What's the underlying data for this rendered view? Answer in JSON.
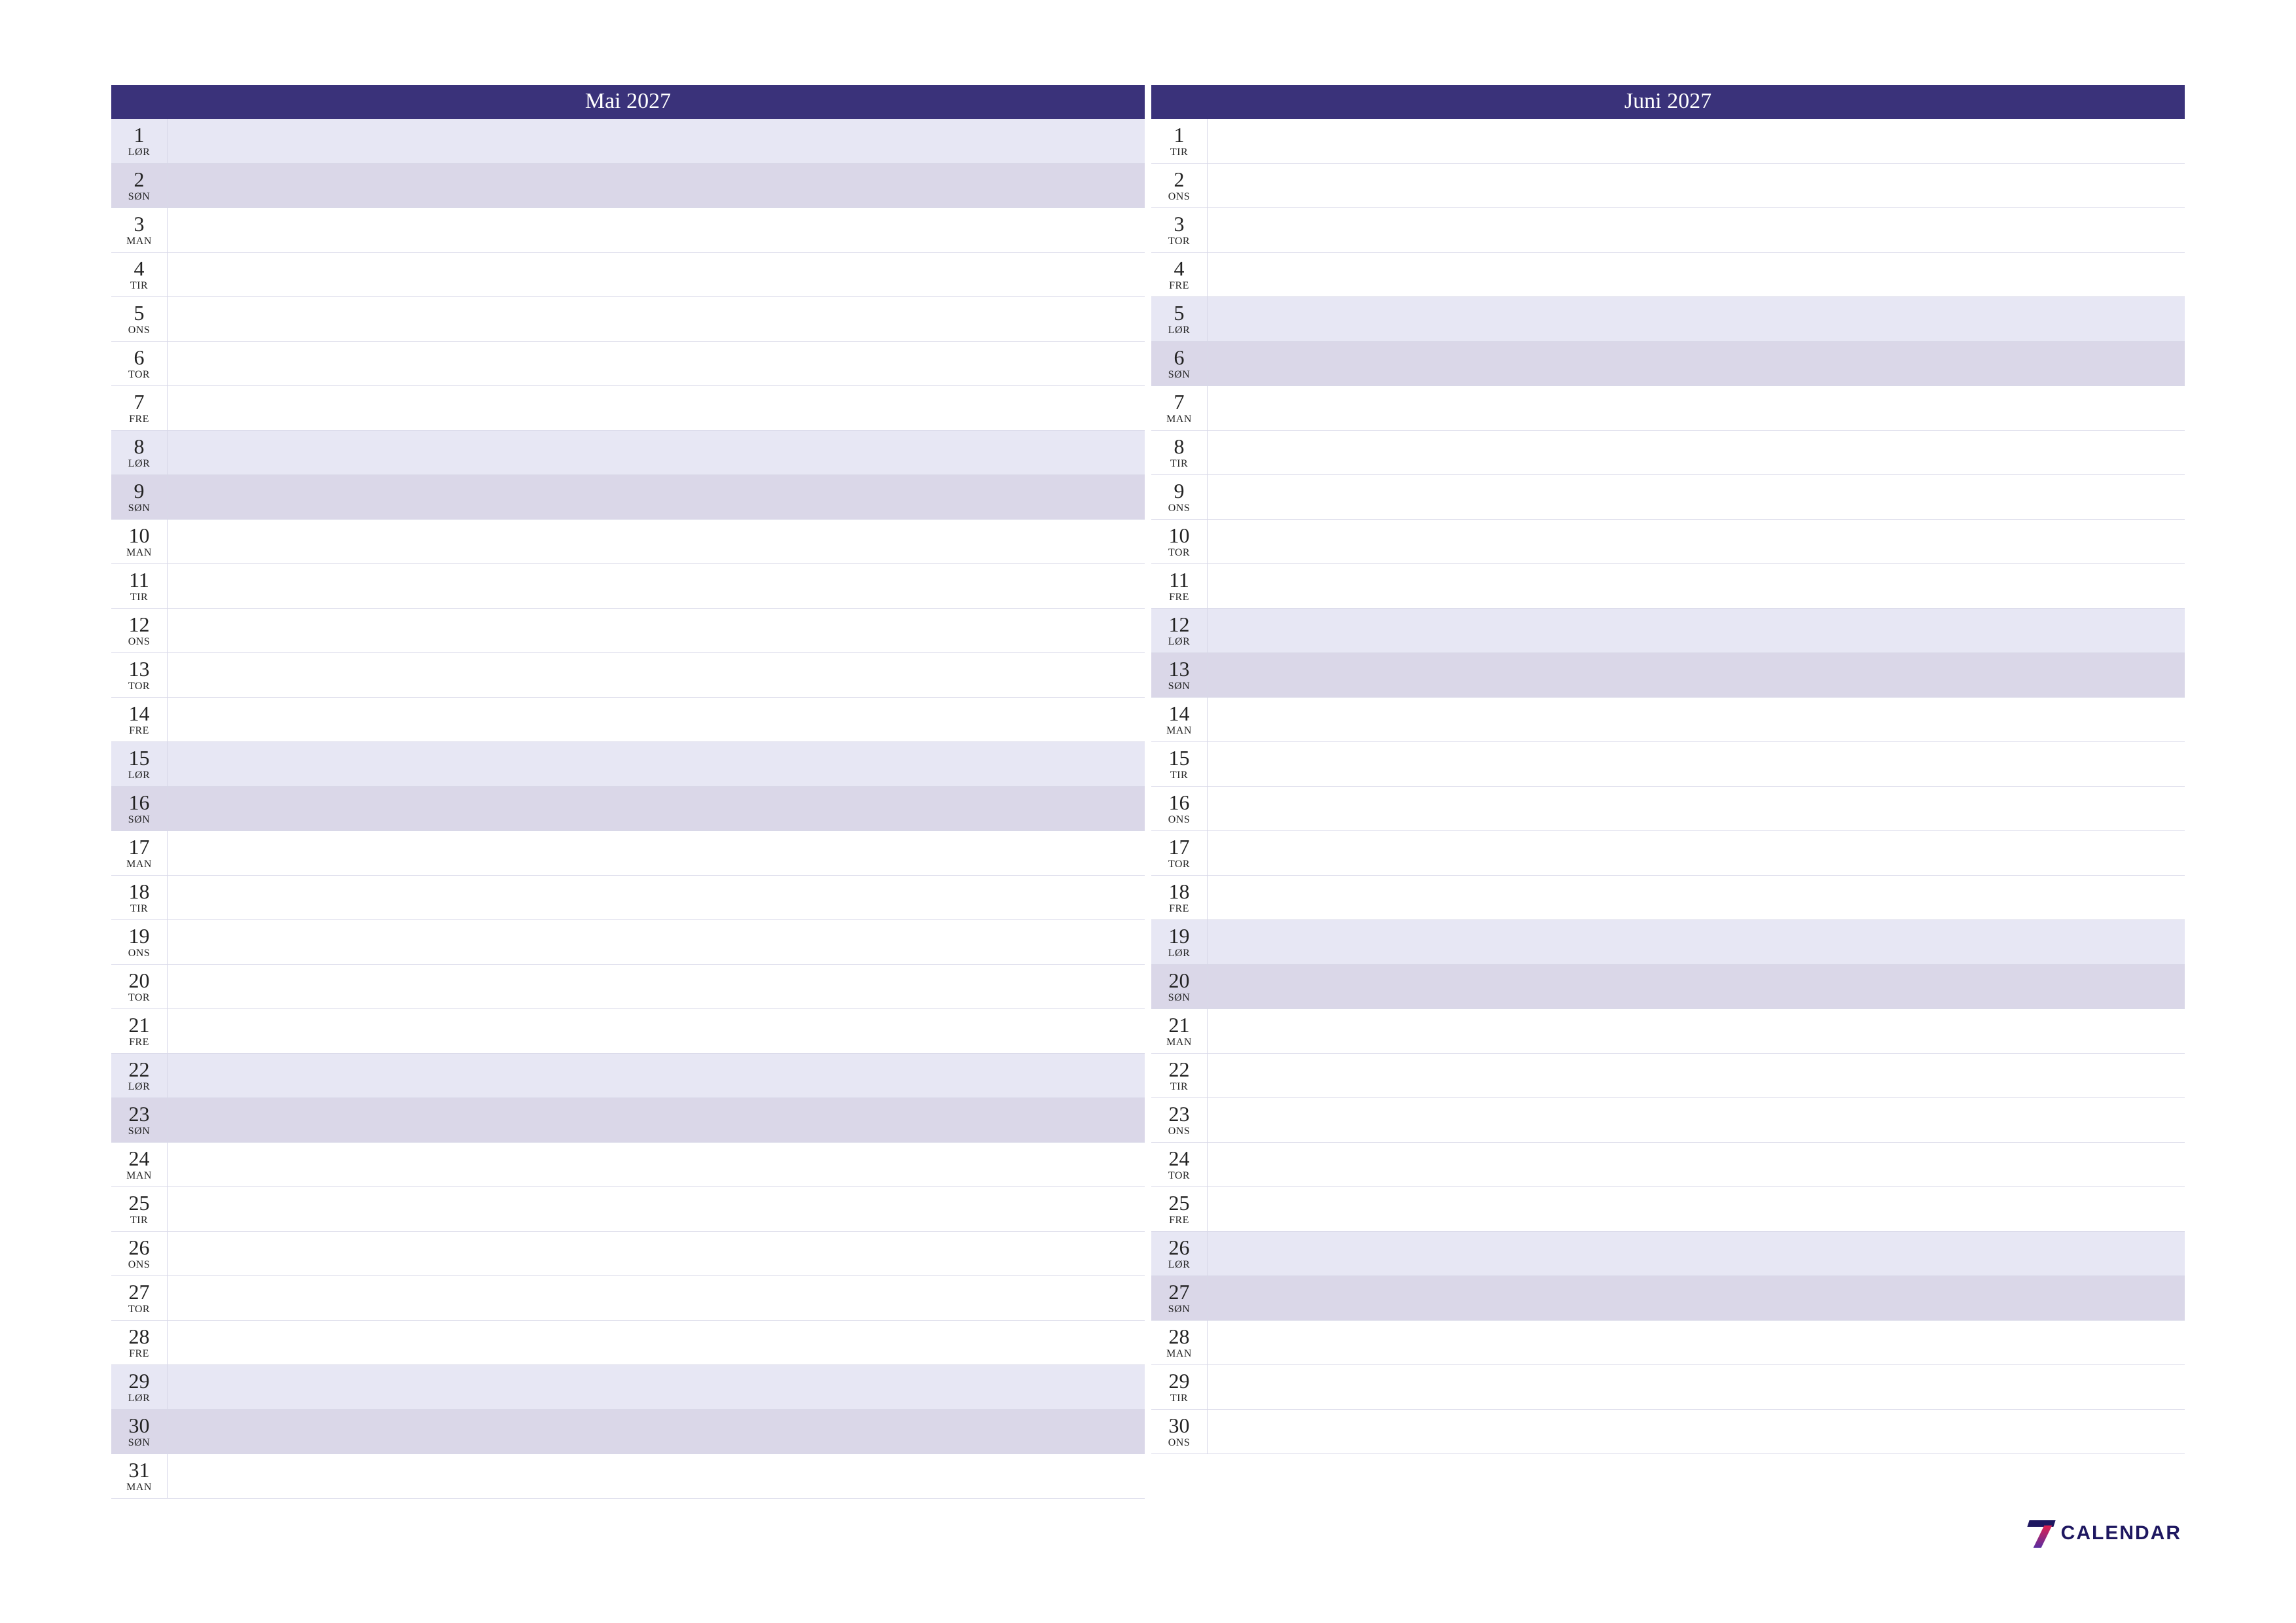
{
  "colors": {
    "header_bg": "#3a327a",
    "sat_bg": "#e7e7f4",
    "sun_bg": "#dad7e8"
  },
  "logo": {
    "text": "CALENDAR"
  },
  "months": [
    {
      "title": "Mai 2027",
      "days": [
        {
          "num": "1",
          "dow": "LØR",
          "type": "sat"
        },
        {
          "num": "2",
          "dow": "SØN",
          "type": "sun"
        },
        {
          "num": "3",
          "dow": "MAN",
          "type": "weekday"
        },
        {
          "num": "4",
          "dow": "TIR",
          "type": "weekday"
        },
        {
          "num": "5",
          "dow": "ONS",
          "type": "weekday"
        },
        {
          "num": "6",
          "dow": "TOR",
          "type": "weekday"
        },
        {
          "num": "7",
          "dow": "FRE",
          "type": "weekday"
        },
        {
          "num": "8",
          "dow": "LØR",
          "type": "sat"
        },
        {
          "num": "9",
          "dow": "SØN",
          "type": "sun"
        },
        {
          "num": "10",
          "dow": "MAN",
          "type": "weekday"
        },
        {
          "num": "11",
          "dow": "TIR",
          "type": "weekday"
        },
        {
          "num": "12",
          "dow": "ONS",
          "type": "weekday"
        },
        {
          "num": "13",
          "dow": "TOR",
          "type": "weekday"
        },
        {
          "num": "14",
          "dow": "FRE",
          "type": "weekday"
        },
        {
          "num": "15",
          "dow": "LØR",
          "type": "sat"
        },
        {
          "num": "16",
          "dow": "SØN",
          "type": "sun"
        },
        {
          "num": "17",
          "dow": "MAN",
          "type": "weekday"
        },
        {
          "num": "18",
          "dow": "TIR",
          "type": "weekday"
        },
        {
          "num": "19",
          "dow": "ONS",
          "type": "weekday"
        },
        {
          "num": "20",
          "dow": "TOR",
          "type": "weekday"
        },
        {
          "num": "21",
          "dow": "FRE",
          "type": "weekday"
        },
        {
          "num": "22",
          "dow": "LØR",
          "type": "sat"
        },
        {
          "num": "23",
          "dow": "SØN",
          "type": "sun"
        },
        {
          "num": "24",
          "dow": "MAN",
          "type": "weekday"
        },
        {
          "num": "25",
          "dow": "TIR",
          "type": "weekday"
        },
        {
          "num": "26",
          "dow": "ONS",
          "type": "weekday"
        },
        {
          "num": "27",
          "dow": "TOR",
          "type": "weekday"
        },
        {
          "num": "28",
          "dow": "FRE",
          "type": "weekday"
        },
        {
          "num": "29",
          "dow": "LØR",
          "type": "sat"
        },
        {
          "num": "30",
          "dow": "SØN",
          "type": "sun"
        },
        {
          "num": "31",
          "dow": "MAN",
          "type": "weekday"
        }
      ]
    },
    {
      "title": "Juni 2027",
      "days": [
        {
          "num": "1",
          "dow": "TIR",
          "type": "weekday"
        },
        {
          "num": "2",
          "dow": "ONS",
          "type": "weekday"
        },
        {
          "num": "3",
          "dow": "TOR",
          "type": "weekday"
        },
        {
          "num": "4",
          "dow": "FRE",
          "type": "weekday"
        },
        {
          "num": "5",
          "dow": "LØR",
          "type": "sat"
        },
        {
          "num": "6",
          "dow": "SØN",
          "type": "sun"
        },
        {
          "num": "7",
          "dow": "MAN",
          "type": "weekday"
        },
        {
          "num": "8",
          "dow": "TIR",
          "type": "weekday"
        },
        {
          "num": "9",
          "dow": "ONS",
          "type": "weekday"
        },
        {
          "num": "10",
          "dow": "TOR",
          "type": "weekday"
        },
        {
          "num": "11",
          "dow": "FRE",
          "type": "weekday"
        },
        {
          "num": "12",
          "dow": "LØR",
          "type": "sat"
        },
        {
          "num": "13",
          "dow": "SØN",
          "type": "sun"
        },
        {
          "num": "14",
          "dow": "MAN",
          "type": "weekday"
        },
        {
          "num": "15",
          "dow": "TIR",
          "type": "weekday"
        },
        {
          "num": "16",
          "dow": "ONS",
          "type": "weekday"
        },
        {
          "num": "17",
          "dow": "TOR",
          "type": "weekday"
        },
        {
          "num": "18",
          "dow": "FRE",
          "type": "weekday"
        },
        {
          "num": "19",
          "dow": "LØR",
          "type": "sat"
        },
        {
          "num": "20",
          "dow": "SØN",
          "type": "sun"
        },
        {
          "num": "21",
          "dow": "MAN",
          "type": "weekday"
        },
        {
          "num": "22",
          "dow": "TIR",
          "type": "weekday"
        },
        {
          "num": "23",
          "dow": "ONS",
          "type": "weekday"
        },
        {
          "num": "24",
          "dow": "TOR",
          "type": "weekday"
        },
        {
          "num": "25",
          "dow": "FRE",
          "type": "weekday"
        },
        {
          "num": "26",
          "dow": "LØR",
          "type": "sat"
        },
        {
          "num": "27",
          "dow": "SØN",
          "type": "sun"
        },
        {
          "num": "28",
          "dow": "MAN",
          "type": "weekday"
        },
        {
          "num": "29",
          "dow": "TIR",
          "type": "weekday"
        },
        {
          "num": "30",
          "dow": "ONS",
          "type": "weekday"
        }
      ]
    }
  ]
}
